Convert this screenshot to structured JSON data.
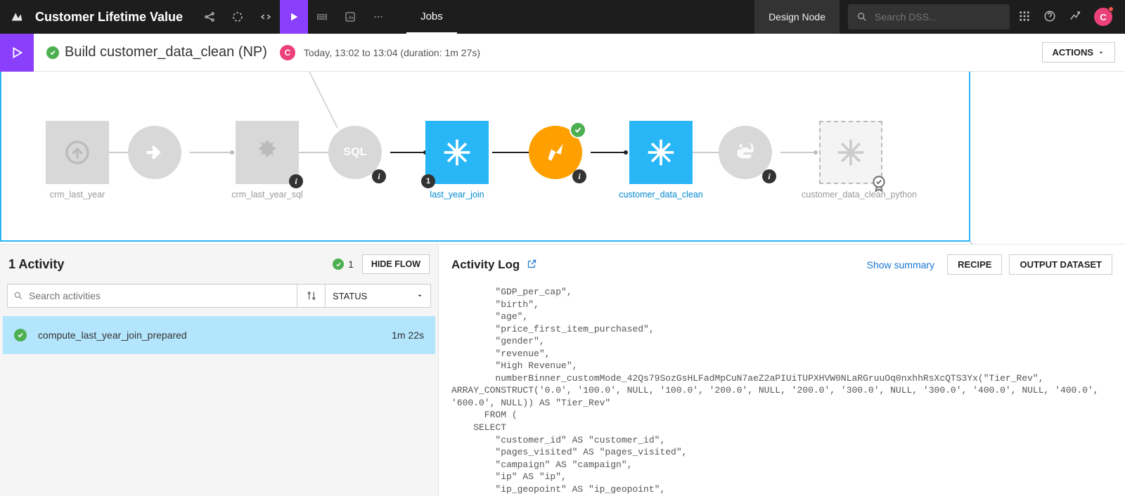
{
  "topnav": {
    "project_name": "Customer Lifetime Value",
    "jobs_label": "Jobs",
    "design_node": "Design Node",
    "search_placeholder": "Search DSS...",
    "avatar_initial": "C"
  },
  "jobheader": {
    "title": "Build customer_data_clean (NP)",
    "user_initial": "C",
    "time_text": "Today, 13:02 to 13:04 (duration: 1m 27s)",
    "actions_label": "ACTIONS"
  },
  "flow": {
    "nodes": {
      "n1": "crm_last_year",
      "n3": "crm_last_year_sql",
      "n5": "last_year_join",
      "n5_badge": "1",
      "n7": "customer_data_clean",
      "n9": "customer_data_clean_python"
    }
  },
  "left": {
    "title": "1 Activity",
    "success_count": "1",
    "hide_flow": "HIDE FLOW",
    "search_placeholder": "Search activities",
    "status_label": "STATUS",
    "activity": {
      "name": "compute_last_year_join_prepared",
      "duration": "1m 22s"
    }
  },
  "right": {
    "title": "Activity Log",
    "show_summary": "Show summary",
    "recipe_btn": "RECIPE",
    "output_btn": "OUTPUT DATASET",
    "log_text": "        \"GDP_per_cap\",\n        \"birth\",\n        \"age\",\n        \"price_first_item_purchased\",\n        \"gender\",\n        \"revenue\",\n        \"High Revenue\",\n        numberBinner_customMode_42Qs79SozGsHLFadMpCuN7aeZ2aPIUiTUPXHVW0NLaRGruuOq0nxhhRsXcQTS3Yx(\"Tier_Rev\",\nARRAY_CONSTRUCT('0.0', '100.0', NULL, '100.0', '200.0', NULL, '200.0', '300.0', NULL, '300.0', '400.0', NULL, '400.0',\n'600.0', NULL)) AS \"Tier_Rev\"\n      FROM (\n    SELECT\n        \"customer_id\" AS \"customer_id\",\n        \"pages_visited\" AS \"pages_visited\",\n        \"campaign\" AS \"campaign\",\n        \"ip\" AS \"ip\",\n        \"ip_geopoint\" AS \"ip_geopoint\",\n        \"Country\" AS \"Country\",\n        \"GDP_per_cap\" AS \"GDP_per_cap\""
  }
}
